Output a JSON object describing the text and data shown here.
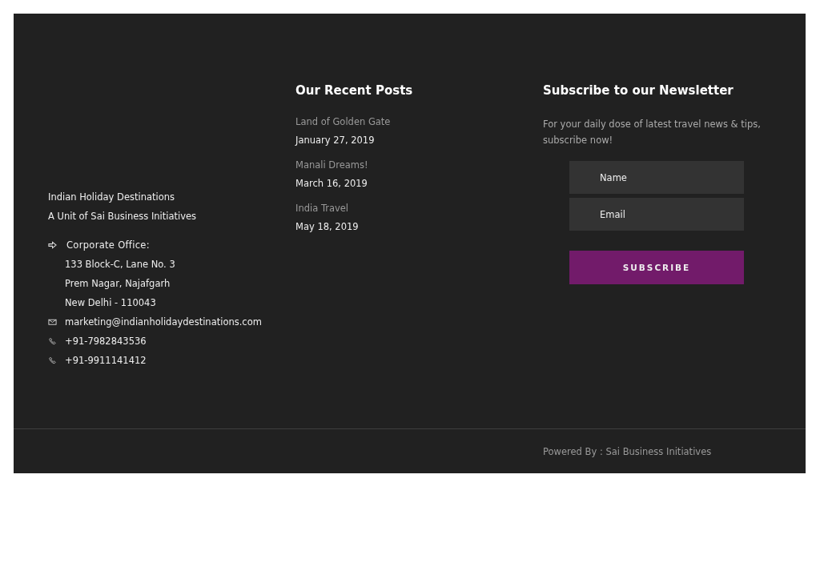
{
  "about": {
    "lines": [
      "Indian Holiday Destinations",
      "A Unit of Sai Business Initiatives"
    ],
    "contacts": [
      {
        "kind": "address",
        "lines": [
          "Corporate Office:",
          "133 Block-C, Lane No. 3",
          "Prem Nagar, Najafgarh",
          "New Delhi - 110043"
        ]
      },
      {
        "kind": "email",
        "lines": [
          "marketing@indianholidaydestinations.com"
        ]
      },
      {
        "kind": "phone",
        "lines": [
          "+91-7982843536"
        ]
      },
      {
        "kind": "phone",
        "lines": [
          "+91-9911141412"
        ]
      }
    ]
  },
  "recent_posts": {
    "heading": "Our Recent Posts",
    "posts": [
      {
        "title": "Land of Golden Gate",
        "date": "January 27, 2019"
      },
      {
        "title": "Manali Dreams!",
        "date": "March 16, 2019"
      },
      {
        "title": "India Travel",
        "date": "May 18, 2019"
      }
    ]
  },
  "newsletter": {
    "heading": "Subscribe to our Newsletter",
    "text": "For your daily dose of latest travel news & tips, subscribe now!",
    "fields": [
      {
        "placeholder": "Name"
      },
      {
        "placeholder": "Email"
      }
    ],
    "button": "SUBSCRIBE"
  },
  "footer": {
    "text": "Powered By : Sai Business Initiatives"
  }
}
